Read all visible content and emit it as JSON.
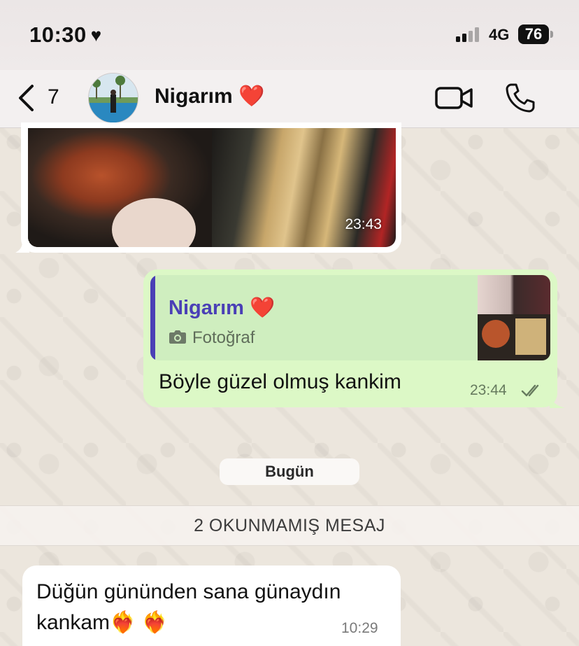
{
  "status_bar": {
    "time": "10:30",
    "time_heart": "♥",
    "network": "4G",
    "battery": "76"
  },
  "header": {
    "back_count": "7",
    "contact_name": "Nigarım",
    "contact_heart": "❤️"
  },
  "messages": [
    {
      "type": "image",
      "direction": "incoming",
      "time": "23:43"
    },
    {
      "type": "text",
      "direction": "outgoing",
      "quote": {
        "name": "Nigarım",
        "heart": "❤️",
        "media_label": "Fotoğraf"
      },
      "text": "Böyle güzel olmuş kankim",
      "time": "23:44",
      "status": "read"
    }
  ],
  "date_separator": "Bugün",
  "unread_banner": "2 OKUNMAMIŞ MESAJ",
  "incoming_last": {
    "text": "Düğün gününden sana günaydın kankam❤️‍🔥 ❤️‍🔥",
    "time": "10:29"
  },
  "colors": {
    "outgoing_bubble": "#dcf8c6",
    "quote_accent": "#4a3fb6",
    "heart": "#d2161e"
  }
}
